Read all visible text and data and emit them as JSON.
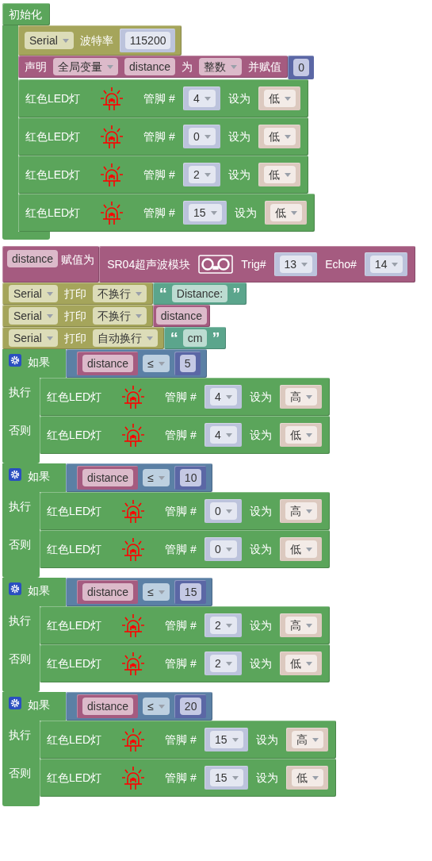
{
  "setup": {
    "title": "初始化",
    "statements": [
      {
        "kind": "serial_begin",
        "port": "Serial",
        "label": "波特率",
        "baud": "115200"
      },
      {
        "kind": "declare",
        "label": "声明",
        "scope": "全局变量",
        "name": "distance",
        "type_label": "为",
        "type": "整数",
        "assign_label": "并赋值",
        "value": "0"
      },
      {
        "kind": "led",
        "label": "红色LED灯",
        "pin_label": "管脚 #",
        "pin": "4",
        "set_label": "设为",
        "state": "低"
      },
      {
        "kind": "led",
        "label": "红色LED灯",
        "pin_label": "管脚 #",
        "pin": "0",
        "set_label": "设为",
        "state": "低"
      },
      {
        "kind": "led",
        "label": "红色LED灯",
        "pin_label": "管脚 #",
        "pin": "2",
        "set_label": "设为",
        "state": "低"
      },
      {
        "kind": "led",
        "label": "红色LED灯",
        "pin_label": "管脚 #",
        "pin": "15",
        "set_label": "设为",
        "state": "低"
      }
    ]
  },
  "program": [
    {
      "kind": "assign",
      "variable": "distance",
      "label": "赋值为",
      "sensor": "SR04超声波模块",
      "trig_label": "Trig#",
      "trig": "13",
      "echo_label": "Echo#",
      "echo": "14"
    },
    {
      "kind": "print",
      "port": "Serial",
      "label": "打印",
      "mode": "不换行",
      "value": {
        "kind": "text",
        "open": "“",
        "text": "Distance:",
        "close": "”"
      }
    },
    {
      "kind": "print",
      "port": "Serial",
      "label": "打印",
      "mode": "不换行",
      "value": {
        "kind": "variable",
        "text": "distance"
      }
    },
    {
      "kind": "print",
      "port": "Serial",
      "label": "打印",
      "mode": "自动换行",
      "value": {
        "kind": "text",
        "open": "“",
        "text": "cm",
        "close": "”"
      }
    },
    {
      "kind": "if_else",
      "label": "如果",
      "condition": {
        "variable": "distance",
        "operator": "≤",
        "value": "5"
      },
      "do_label": "执行",
      "do": [
        {
          "kind": "led",
          "label": "红色LED灯",
          "pin_label": "管脚 #",
          "pin": "4",
          "set_label": "设为",
          "state": "高"
        }
      ],
      "else_label": "否则",
      "else": [
        {
          "kind": "led",
          "label": "红色LED灯",
          "pin_label": "管脚 #",
          "pin": "4",
          "set_label": "设为",
          "state": "低"
        }
      ]
    },
    {
      "kind": "if_else",
      "label": "如果",
      "condition": {
        "variable": "distance",
        "operator": "≤",
        "value": "10"
      },
      "do_label": "执行",
      "do": [
        {
          "kind": "led",
          "label": "红色LED灯",
          "pin_label": "管脚 #",
          "pin": "0",
          "set_label": "设为",
          "state": "高"
        }
      ],
      "else_label": "否则",
      "else": [
        {
          "kind": "led",
          "label": "红色LED灯",
          "pin_label": "管脚 #",
          "pin": "0",
          "set_label": "设为",
          "state": "低"
        }
      ]
    },
    {
      "kind": "if_else",
      "label": "如果",
      "condition": {
        "variable": "distance",
        "operator": "≤",
        "value": "15"
      },
      "do_label": "执行",
      "do": [
        {
          "kind": "led",
          "label": "红色LED灯",
          "pin_label": "管脚 #",
          "pin": "2",
          "set_label": "设为",
          "state": "高"
        }
      ],
      "else_label": "否则",
      "else": [
        {
          "kind": "led",
          "label": "红色LED灯",
          "pin_label": "管脚 #",
          "pin": "2",
          "set_label": "设为",
          "state": "低"
        }
      ]
    },
    {
      "kind": "if_else",
      "label": "如果",
      "condition": {
        "variable": "distance",
        "operator": "≤",
        "value": "20"
      },
      "do_label": "执行",
      "do": [
        {
          "kind": "led",
          "label": "红色LED灯",
          "pin_label": "管脚 #",
          "pin": "15",
          "set_label": "设为",
          "state": "高"
        }
      ],
      "else_label": "否则",
      "else": [
        {
          "kind": "led",
          "label": "红色LED灯",
          "pin_label": "管脚 #",
          "pin": "15",
          "set_label": "设为",
          "state": "低"
        }
      ]
    }
  ]
}
